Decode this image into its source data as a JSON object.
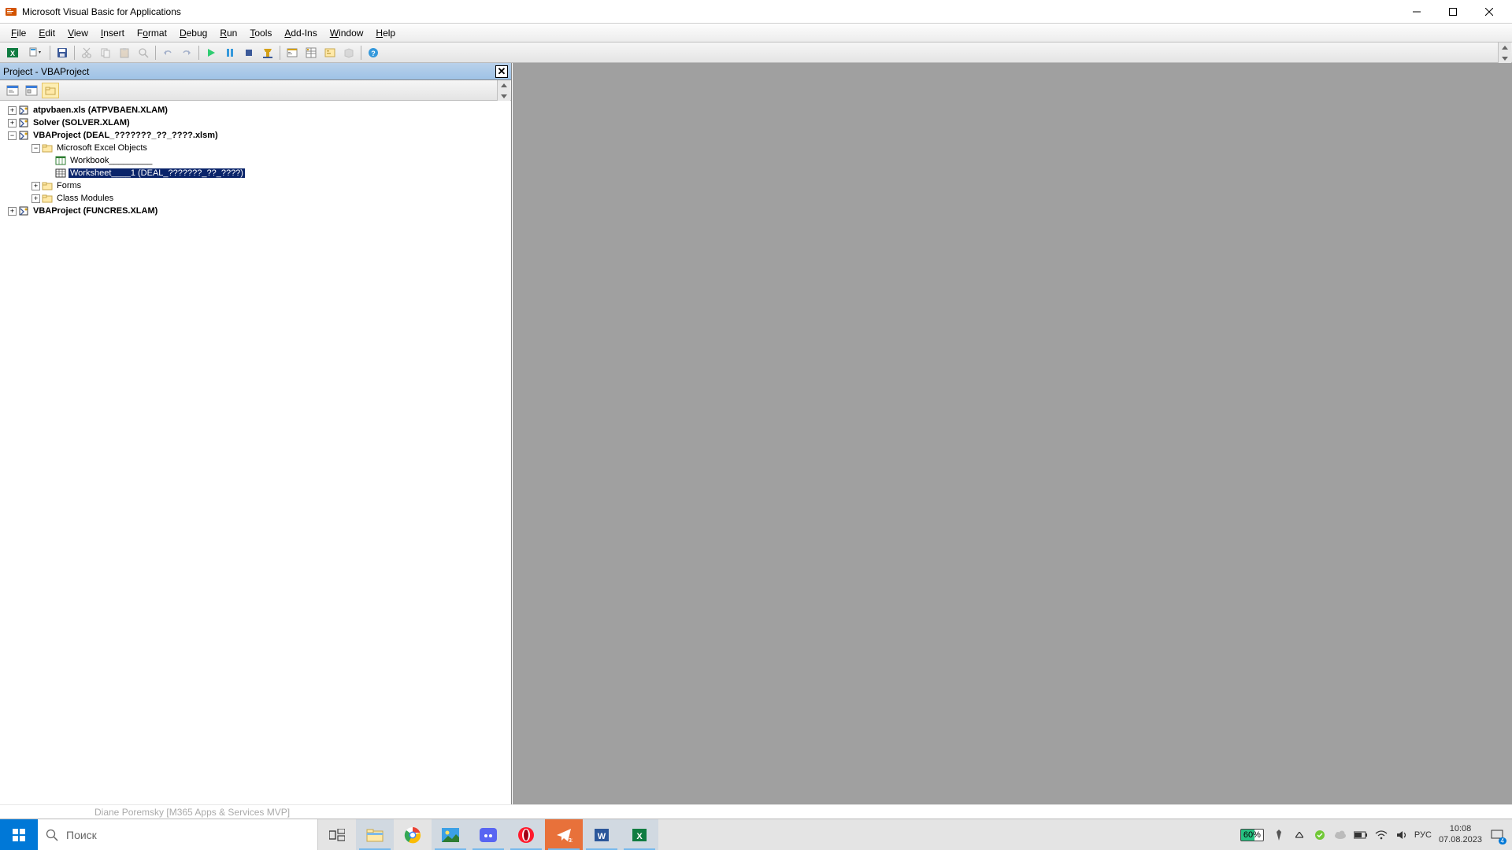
{
  "window": {
    "title": "Microsoft Visual Basic for Applications"
  },
  "menubar": {
    "file": "File",
    "edit": "Edit",
    "view": "View",
    "insert": "Insert",
    "format": "Format",
    "debug": "Debug",
    "run": "Run",
    "tools": "Tools",
    "addins": "Add-Ins",
    "window": "Window",
    "help": "Help"
  },
  "project_panel": {
    "title": "Project - VBAProject"
  },
  "tree": {
    "n0": "atpvbaen.xls (ATPVBAEN.XLAM)",
    "n1": "Solver (SOLVER.XLAM)",
    "n2": "VBAProject (DEAL_???????_??_????.xlsm)",
    "n2a": "Microsoft Excel Objects",
    "n2a1": "Workbook_________",
    "n2a2": "Worksheet____1 (DEAL_???????_??_????)",
    "n2b": "Forms",
    "n2c": "Class Modules",
    "n3": "VBAProject (FUNCRES.XLAM)"
  },
  "footer_text": "Diane Poremsky [M365 Apps & Services MVP]",
  "taskbar": {
    "search_placeholder": "Поиск",
    "battery": "60%",
    "lang": "РУС",
    "time": "10:08",
    "date": "07.08.2023",
    "notif_count": "4"
  }
}
